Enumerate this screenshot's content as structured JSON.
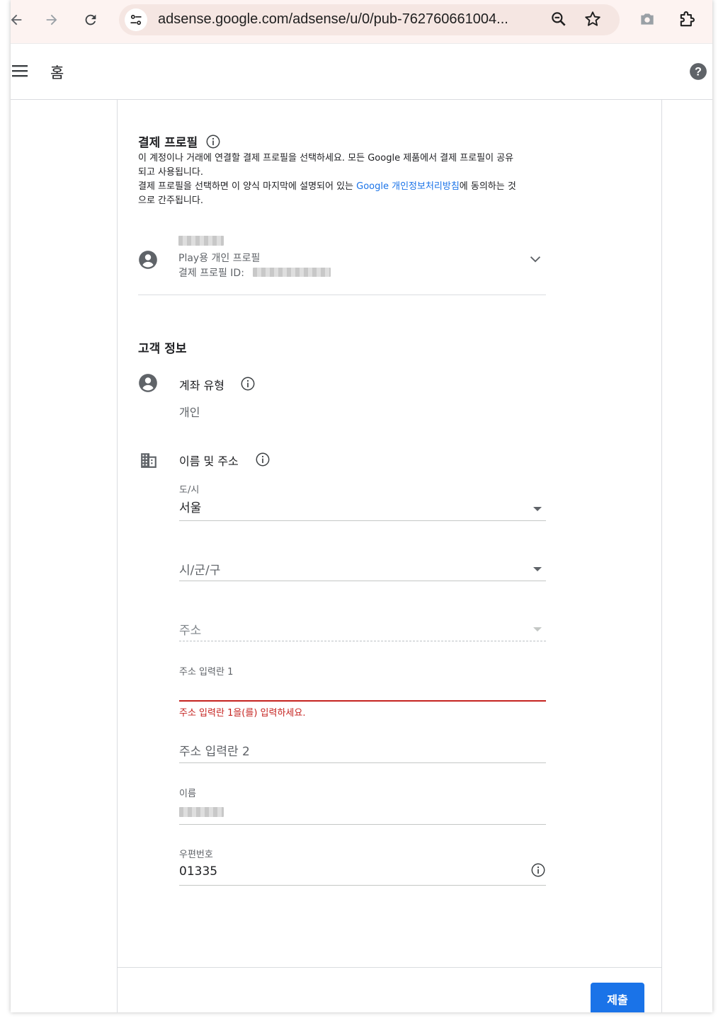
{
  "browser": {
    "url": "adsense.google.com/adsense/u/0/pub-762760661004..."
  },
  "header": {
    "title": "홈"
  },
  "payment_profile": {
    "title": "결제 프로필",
    "desc_line1": "이 계정이나 거래에 연결할 결제 프로필을 선택하세요. 모든 Google 제품에서 결제 프로필이 공유",
    "desc_line2": "되고 사용됩니다.",
    "desc_line3_pre": "결제 프로필을 선택하면 이 양식 마지막에 설명되어 있는 ",
    "desc_link": "Google 개인정보처리방침",
    "desc_line3_post": "에 동의하는 것",
    "desc_line4": "으로 간주됩니다.",
    "profile_type": "Play용 개인 프로필",
    "profile_id_label": "결제 프로필 ID:"
  },
  "customer_info": {
    "title": "고객 정보",
    "account_type_label": "계좌 유형",
    "account_type_value": "개인",
    "name_address_label": "이름 및 주소"
  },
  "form": {
    "city_label": "도/시",
    "city_value": "서울",
    "district_placeholder": "시/군/구",
    "address_placeholder": "주소",
    "address1_label": "주소 입력란 1",
    "address1_error": "주소 입력란 1을(를) 입력하세요.",
    "address2_placeholder": "주소 입력란 2",
    "name_label": "이름",
    "postal_label": "우편번호",
    "postal_value": "01335"
  },
  "actions": {
    "submit_label": "제출"
  },
  "colors": {
    "accent": "#1a73e8",
    "error": "#c5221f",
    "browser_bar": "#fdf3f1"
  }
}
